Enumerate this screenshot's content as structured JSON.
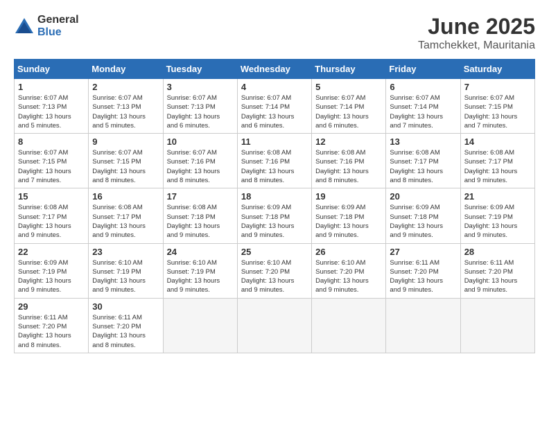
{
  "logo": {
    "general": "General",
    "blue": "Blue"
  },
  "title": "June 2025",
  "subtitle": "Tamchekket, Mauritania",
  "headers": [
    "Sunday",
    "Monday",
    "Tuesday",
    "Wednesday",
    "Thursday",
    "Friday",
    "Saturday"
  ],
  "days": [
    {
      "num": "",
      "detail": ""
    },
    {
      "num": "",
      "detail": ""
    },
    {
      "num": "",
      "detail": ""
    },
    {
      "num": "",
      "detail": ""
    },
    {
      "num": "",
      "detail": ""
    },
    {
      "num": "",
      "detail": ""
    },
    {
      "num": "1",
      "detail": "Sunrise: 6:07 AM\nSunset: 7:13 PM\nDaylight: 13 hours\nand 5 minutes."
    },
    {
      "num": "2",
      "detail": "Sunrise: 6:07 AM\nSunset: 7:13 PM\nDaylight: 13 hours\nand 5 minutes."
    },
    {
      "num": "3",
      "detail": "Sunrise: 6:07 AM\nSunset: 7:13 PM\nDaylight: 13 hours\nand 6 minutes."
    },
    {
      "num": "4",
      "detail": "Sunrise: 6:07 AM\nSunset: 7:14 PM\nDaylight: 13 hours\nand 6 minutes."
    },
    {
      "num": "5",
      "detail": "Sunrise: 6:07 AM\nSunset: 7:14 PM\nDaylight: 13 hours\nand 6 minutes."
    },
    {
      "num": "6",
      "detail": "Sunrise: 6:07 AM\nSunset: 7:14 PM\nDaylight: 13 hours\nand 7 minutes."
    },
    {
      "num": "7",
      "detail": "Sunrise: 6:07 AM\nSunset: 7:15 PM\nDaylight: 13 hours\nand 7 minutes."
    },
    {
      "num": "8",
      "detail": "Sunrise: 6:07 AM\nSunset: 7:15 PM\nDaylight: 13 hours\nand 7 minutes."
    },
    {
      "num": "9",
      "detail": "Sunrise: 6:07 AM\nSunset: 7:15 PM\nDaylight: 13 hours\nand 8 minutes."
    },
    {
      "num": "10",
      "detail": "Sunrise: 6:07 AM\nSunset: 7:16 PM\nDaylight: 13 hours\nand 8 minutes."
    },
    {
      "num": "11",
      "detail": "Sunrise: 6:08 AM\nSunset: 7:16 PM\nDaylight: 13 hours\nand 8 minutes."
    },
    {
      "num": "12",
      "detail": "Sunrise: 6:08 AM\nSunset: 7:16 PM\nDaylight: 13 hours\nand 8 minutes."
    },
    {
      "num": "13",
      "detail": "Sunrise: 6:08 AM\nSunset: 7:17 PM\nDaylight: 13 hours\nand 8 minutes."
    },
    {
      "num": "14",
      "detail": "Sunrise: 6:08 AM\nSunset: 7:17 PM\nDaylight: 13 hours\nand 9 minutes."
    },
    {
      "num": "15",
      "detail": "Sunrise: 6:08 AM\nSunset: 7:17 PM\nDaylight: 13 hours\nand 9 minutes."
    },
    {
      "num": "16",
      "detail": "Sunrise: 6:08 AM\nSunset: 7:17 PM\nDaylight: 13 hours\nand 9 minutes."
    },
    {
      "num": "17",
      "detail": "Sunrise: 6:08 AM\nSunset: 7:18 PM\nDaylight: 13 hours\nand 9 minutes."
    },
    {
      "num": "18",
      "detail": "Sunrise: 6:09 AM\nSunset: 7:18 PM\nDaylight: 13 hours\nand 9 minutes."
    },
    {
      "num": "19",
      "detail": "Sunrise: 6:09 AM\nSunset: 7:18 PM\nDaylight: 13 hours\nand 9 minutes."
    },
    {
      "num": "20",
      "detail": "Sunrise: 6:09 AM\nSunset: 7:18 PM\nDaylight: 13 hours\nand 9 minutes."
    },
    {
      "num": "21",
      "detail": "Sunrise: 6:09 AM\nSunset: 7:19 PM\nDaylight: 13 hours\nand 9 minutes."
    },
    {
      "num": "22",
      "detail": "Sunrise: 6:09 AM\nSunset: 7:19 PM\nDaylight: 13 hours\nand 9 minutes."
    },
    {
      "num": "23",
      "detail": "Sunrise: 6:10 AM\nSunset: 7:19 PM\nDaylight: 13 hours\nand 9 minutes."
    },
    {
      "num": "24",
      "detail": "Sunrise: 6:10 AM\nSunset: 7:19 PM\nDaylight: 13 hours\nand 9 minutes."
    },
    {
      "num": "25",
      "detail": "Sunrise: 6:10 AM\nSunset: 7:20 PM\nDaylight: 13 hours\nand 9 minutes."
    },
    {
      "num": "26",
      "detail": "Sunrise: 6:10 AM\nSunset: 7:20 PM\nDaylight: 13 hours\nand 9 minutes."
    },
    {
      "num": "27",
      "detail": "Sunrise: 6:11 AM\nSunset: 7:20 PM\nDaylight: 13 hours\nand 9 minutes."
    },
    {
      "num": "28",
      "detail": "Sunrise: 6:11 AM\nSunset: 7:20 PM\nDaylight: 13 hours\nand 9 minutes."
    },
    {
      "num": "29",
      "detail": "Sunrise: 6:11 AM\nSunset: 7:20 PM\nDaylight: 13 hours\nand 8 minutes."
    },
    {
      "num": "30",
      "detail": "Sunrise: 6:11 AM\nSunset: 7:20 PM\nDaylight: 13 hours\nand 8 minutes."
    },
    {
      "num": "",
      "detail": ""
    },
    {
      "num": "",
      "detail": ""
    },
    {
      "num": "",
      "detail": ""
    },
    {
      "num": "",
      "detail": ""
    },
    {
      "num": "",
      "detail": ""
    }
  ]
}
